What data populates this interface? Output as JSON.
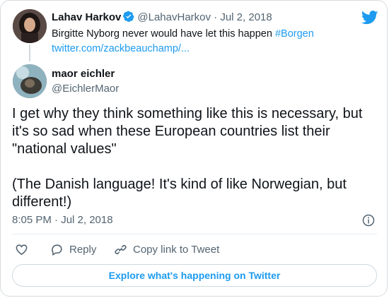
{
  "colors": {
    "accent": "#1d9bf0",
    "text_primary": "#0f1419",
    "text_secondary": "#536471",
    "border": "#cfd9de"
  },
  "icons": {
    "brand": "twitter-bird-icon",
    "verified": "verified-badge-icon",
    "info": "info-icon",
    "like": "heart-icon",
    "reply": "reply-bubble-icon",
    "copy_link": "link-icon"
  },
  "quoted_tweet": {
    "author_name": "Lahav Harkov",
    "author_handle": "@LahavHarkov",
    "separator": "·",
    "date": "Jul 2, 2018",
    "text": "Birgitte Nyborg never would have let this happen ",
    "hashtag": "#Borgen",
    "link": "twitter.com/zackbeauchamp/..."
  },
  "tweet": {
    "author_name": "maor eichler",
    "author_handle": "@EichlerMaor",
    "paragraph_1": "I get why they think something like this is necessary, but it's so sad when these European countries list their \"national values\"",
    "paragraph_2": "(The Danish language! It's kind of like Norwegian, but different!)",
    "timestamp": "8:05 PM · Jul 2, 2018"
  },
  "actions": {
    "reply_label": "Reply",
    "copy_link_label": "Copy link to Tweet"
  },
  "explore_button": {
    "label": "Explore what's happening on Twitter"
  }
}
